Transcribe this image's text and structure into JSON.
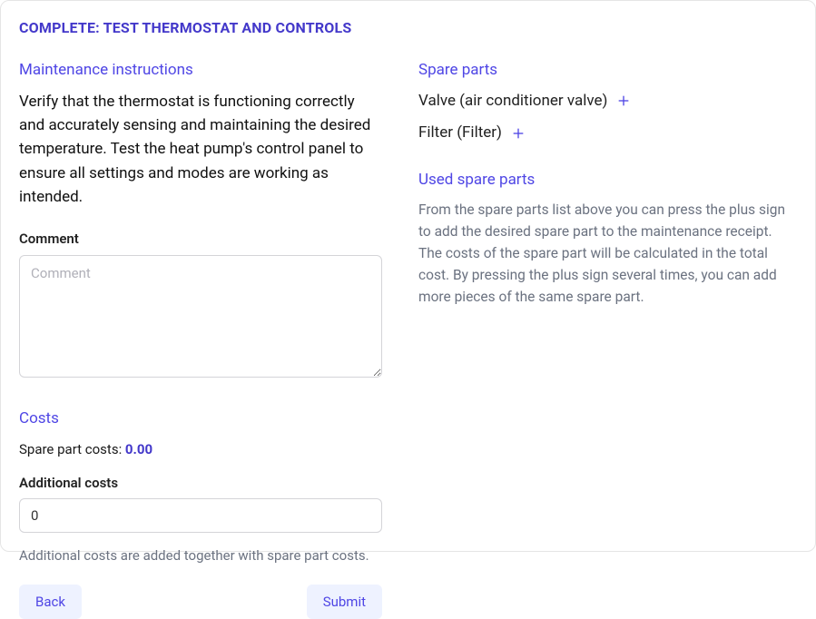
{
  "page_title": "COMPLETE: TEST THERMOSTAT AND CONTROLS",
  "left": {
    "instructions_heading": "Maintenance instructions",
    "instructions_text": "Verify that the thermostat is functioning correctly and accurately sensing and maintaining the desired temperature. Test the heat pump's control panel to ensure all settings and modes are working as intended.",
    "comment_label": "Comment",
    "comment_placeholder": "Comment",
    "comment_value": "",
    "costs_heading": "Costs",
    "spare_cost_label": "Spare part costs: ",
    "spare_cost_value": "0.00",
    "additional_costs_label": "Additional costs",
    "additional_costs_value": "0",
    "additional_costs_help": "Additional costs are added together with spare part costs.",
    "back_label": "Back",
    "submit_label": "Submit"
  },
  "right": {
    "spare_parts_heading": "Spare parts",
    "spare_parts": [
      {
        "label": "Valve (air conditioner valve)"
      },
      {
        "label": "Filter (Filter)"
      }
    ],
    "used_heading": "Used spare parts",
    "used_desc": "From the spare parts list above you can press the plus sign to add the desired spare part to the maintenance receipt. The costs of the spare part will be calculated in the total cost. By pressing the plus sign several times, you can add more pieces of the same spare part."
  }
}
